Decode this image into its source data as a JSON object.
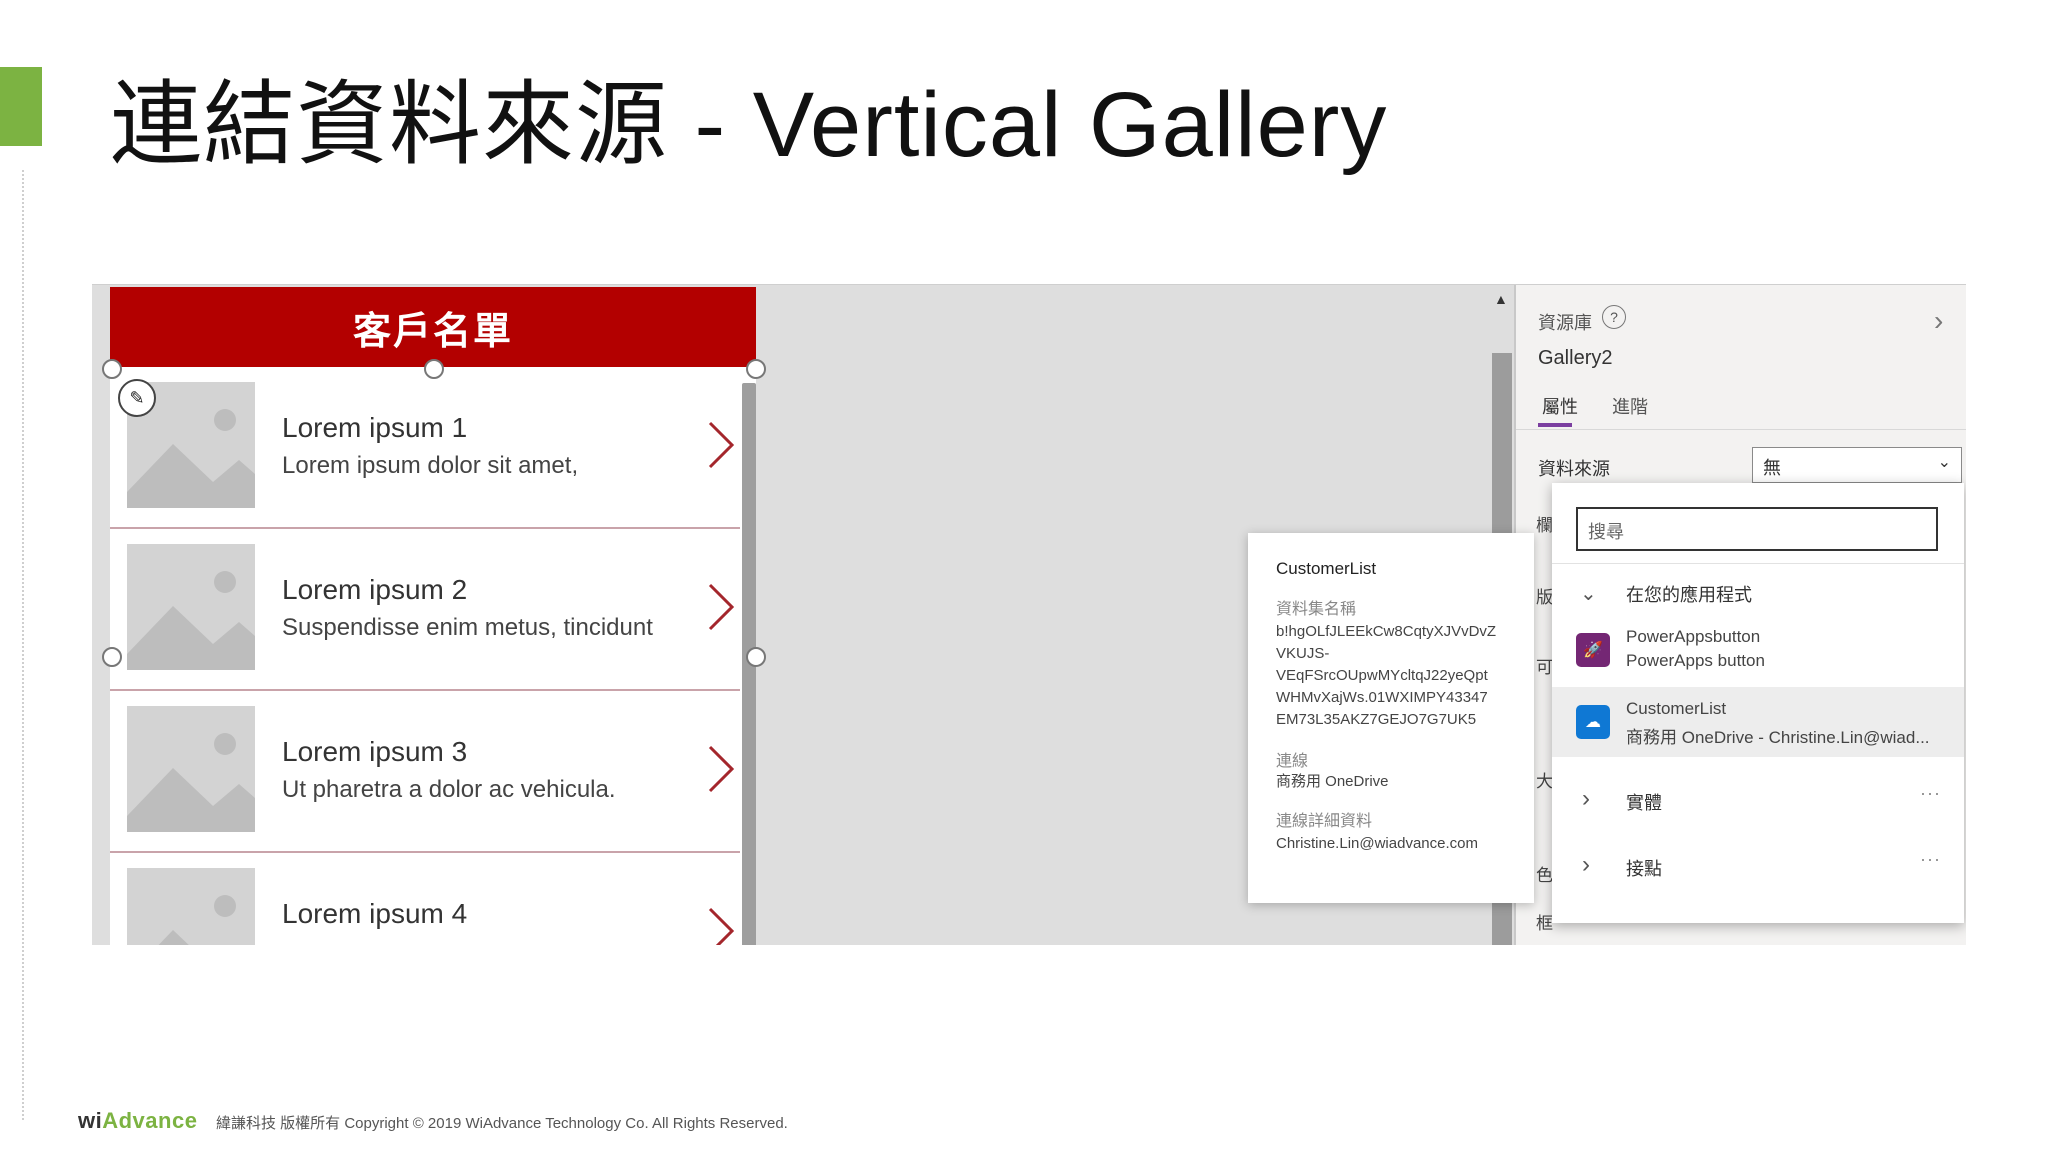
{
  "slide": {
    "title": "連結資料來源 - Vertical Gallery",
    "accent_color": "#7cb342"
  },
  "gallery": {
    "header": "客戶名單",
    "header_color": "#b30000",
    "items": [
      {
        "title": "Lorem ipsum 1",
        "subtitle": "Lorem ipsum dolor sit amet,"
      },
      {
        "title": "Lorem ipsum 2",
        "subtitle": "Suspendisse enim metus, tincidunt"
      },
      {
        "title": "Lorem ipsum 3",
        "subtitle": "Ut pharetra a dolor ac vehicula."
      },
      {
        "title": "Lorem ipsum 4",
        "subtitle": ""
      }
    ]
  },
  "properties_panel": {
    "section_label": "資源庫",
    "control_name": "Gallery2",
    "tabs": [
      "屬性",
      "進階"
    ],
    "data_source_label": "資料來源",
    "data_source_value": "無",
    "side_labels": [
      "欄",
      "版",
      "可",
      "大",
      "色",
      "框"
    ]
  },
  "tooltip": {
    "title": "CustomerList",
    "dataset_label": "資料集名稱",
    "dataset_value": "b!hgOLfJLEEkCw8CqtyXJVvDvZ\nVKUJS-\nVEqFSrcOUpwMYcltqJ22yeQpt\nWHMvXajWs.01WXIMPY43347\nEM73L35AKZ7GEJO7G7UK5",
    "connection_label": "連線",
    "connection_value": "商務用 OneDrive",
    "connection_detail_label": "連線詳細資料",
    "connection_detail_value": "Christine.Lin@wiadvance.com"
  },
  "dropdown": {
    "search_placeholder": "搜尋",
    "group_label": "在您的應用程式",
    "items": [
      {
        "name": "PowerAppsbutton",
        "sub": "PowerApps button",
        "icon": "rocket-icon",
        "color": "#742774"
      },
      {
        "name": "CustomerList",
        "sub": "商務用 OneDrive - Christine.Lin@wiad...",
        "icon": "onedrive-icon",
        "color": "#0f78d4"
      }
    ],
    "expanders": [
      {
        "label": "實體",
        "more": "···"
      },
      {
        "label": "接點",
        "more": "···"
      }
    ]
  },
  "footer": {
    "logo_prefix": "wi",
    "logo_accent": "Advance",
    "copyright": "緯謙科技 版權所有 Copyright © 2019 WiAdvance Technology Co. All Rights Reserved."
  }
}
